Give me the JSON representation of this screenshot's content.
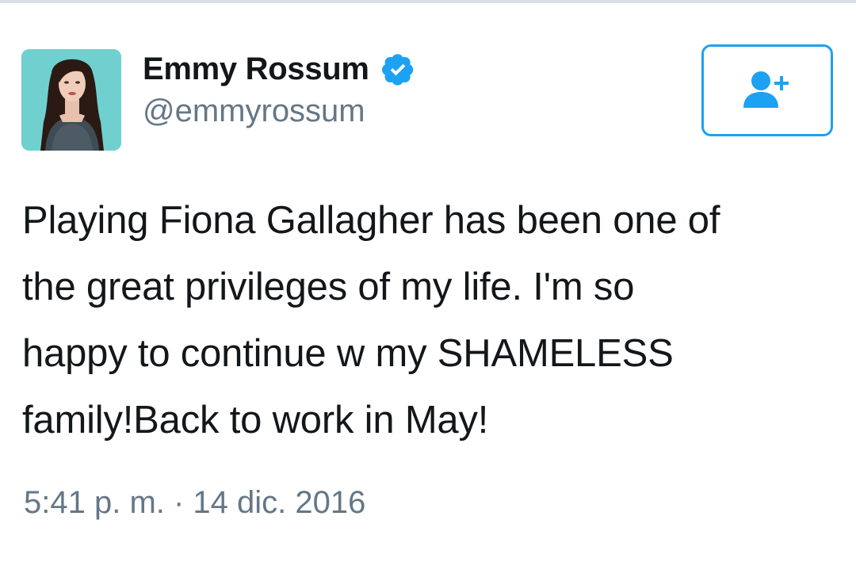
{
  "tweet": {
    "author": {
      "display_name": "Emmy Rossum",
      "handle": "@emmyrossum",
      "verified": true,
      "verified_icon": "verified-badge-icon",
      "avatar_icon": "profile-photo"
    },
    "follow_button": {
      "icon": "add-user-icon"
    },
    "text": "Playing Fiona Gallagher has been one of\nthe great privileges of my life. I'm so\nhappy to continue w my SHAMELESS\nfamily!Back to work in May!",
    "timestamp": "5:41 p. m. · 14 dic. 2016"
  },
  "colors": {
    "accent": "#1da1f2",
    "text_primary": "#14171a",
    "text_secondary": "#657786",
    "avatar_bg": "#6fd0cf"
  }
}
